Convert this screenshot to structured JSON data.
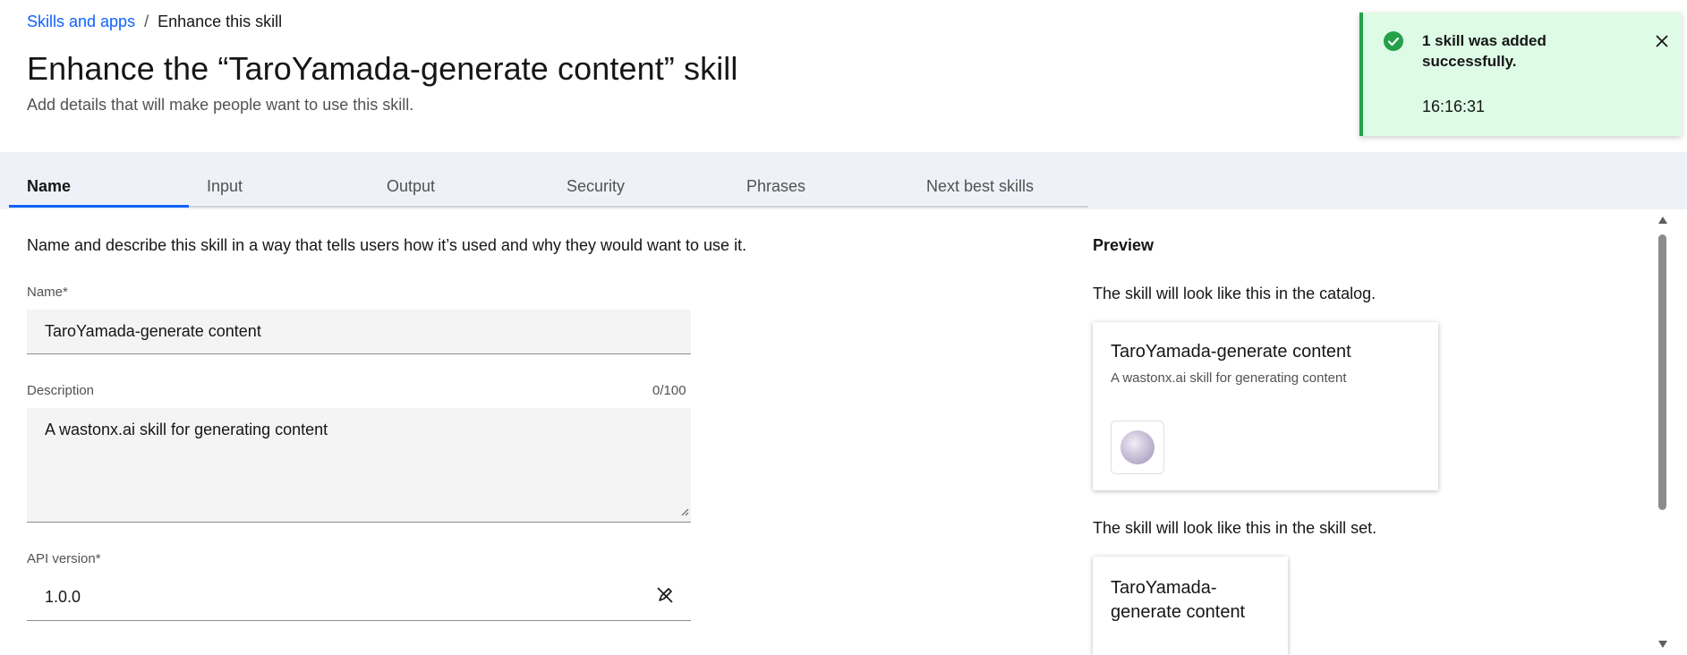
{
  "breadcrumb": {
    "parent": "Skills and apps",
    "separator": "/",
    "current": "Enhance this skill"
  },
  "header": {
    "title": "Enhance the “TaroYamada-generate content” skill",
    "subtitle": "Add details that will make people want to use this skill."
  },
  "tabs": [
    {
      "label": "Name",
      "active": true
    },
    {
      "label": "Input",
      "active": false
    },
    {
      "label": "Output",
      "active": false
    },
    {
      "label": "Security",
      "active": false
    },
    {
      "label": "Phrases",
      "active": false
    },
    {
      "label": "Next best skills",
      "active": false
    }
  ],
  "form": {
    "intro": "Name and describe this skill in a way that tells users how it’s used and why they would want to use it.",
    "name_label": "Name*",
    "name_value": "TaroYamada-generate content",
    "description_label": "Description",
    "description_counter": "0/100",
    "description_value": "A wastonx.ai skill for generating content",
    "api_version_label": "API version*",
    "api_version_value": "1.0.0"
  },
  "preview": {
    "title": "Preview",
    "catalog_caption": "The skill will look like this in the catalog.",
    "catalog_card": {
      "title": "TaroYamada-generate content",
      "description": "A wastonx.ai skill for generating content"
    },
    "skillset_caption": "The skill will look like this in the skill set.",
    "skillset_card": {
      "title": "TaroYamada-generate content"
    }
  },
  "toast": {
    "title": "1 skill was added successfully.",
    "time": "16:16:31",
    "icon": "checkmark-filled-icon"
  },
  "colors": {
    "link": "#0f62fe",
    "tab_indicator": "#0f62fe",
    "toast_background": "#defbe6",
    "toast_accent": "#24a148"
  }
}
